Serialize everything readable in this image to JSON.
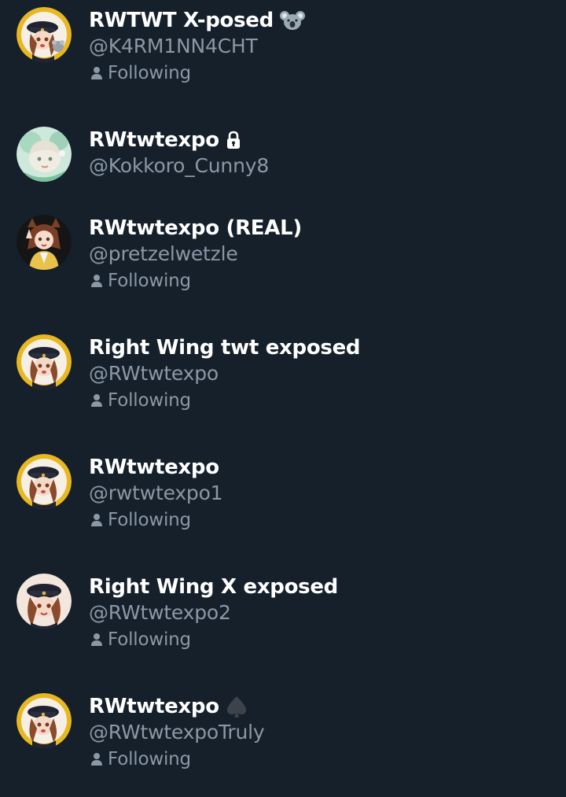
{
  "colors": {
    "background": "#15202b",
    "name_text": "#ffffff",
    "secondary_text": "#8b98a5"
  },
  "accounts": [
    {
      "name": "RWTWT X-posed",
      "handle": "@K4RM1NN4CHT",
      "badge_icon": "koala-emoji-icon",
      "following_label": "Following"
    },
    {
      "name": "RWtwtexpo",
      "handle": "@Kokkoro_Cunny8",
      "badge_icon": "lock-icon"
    },
    {
      "name": "RWtwtexpo (REAL)",
      "handle": "@pretzelwetzle",
      "following_label": "Following"
    },
    {
      "name": "Right Wing twt exposed",
      "handle": "@RWtwtexpo",
      "following_label": "Following"
    },
    {
      "name": "RWtwtexpo",
      "handle": "@rwtwtexpo1",
      "following_label": "Following"
    },
    {
      "name": "Right Wing X exposed",
      "handle": "@RWtwtexpo2",
      "following_label": "Following"
    },
    {
      "name": "RWtwtexpo",
      "handle": "@RWtwtexpoTruly",
      "badge_icon": "spade-icon",
      "following_label": "Following"
    }
  ]
}
